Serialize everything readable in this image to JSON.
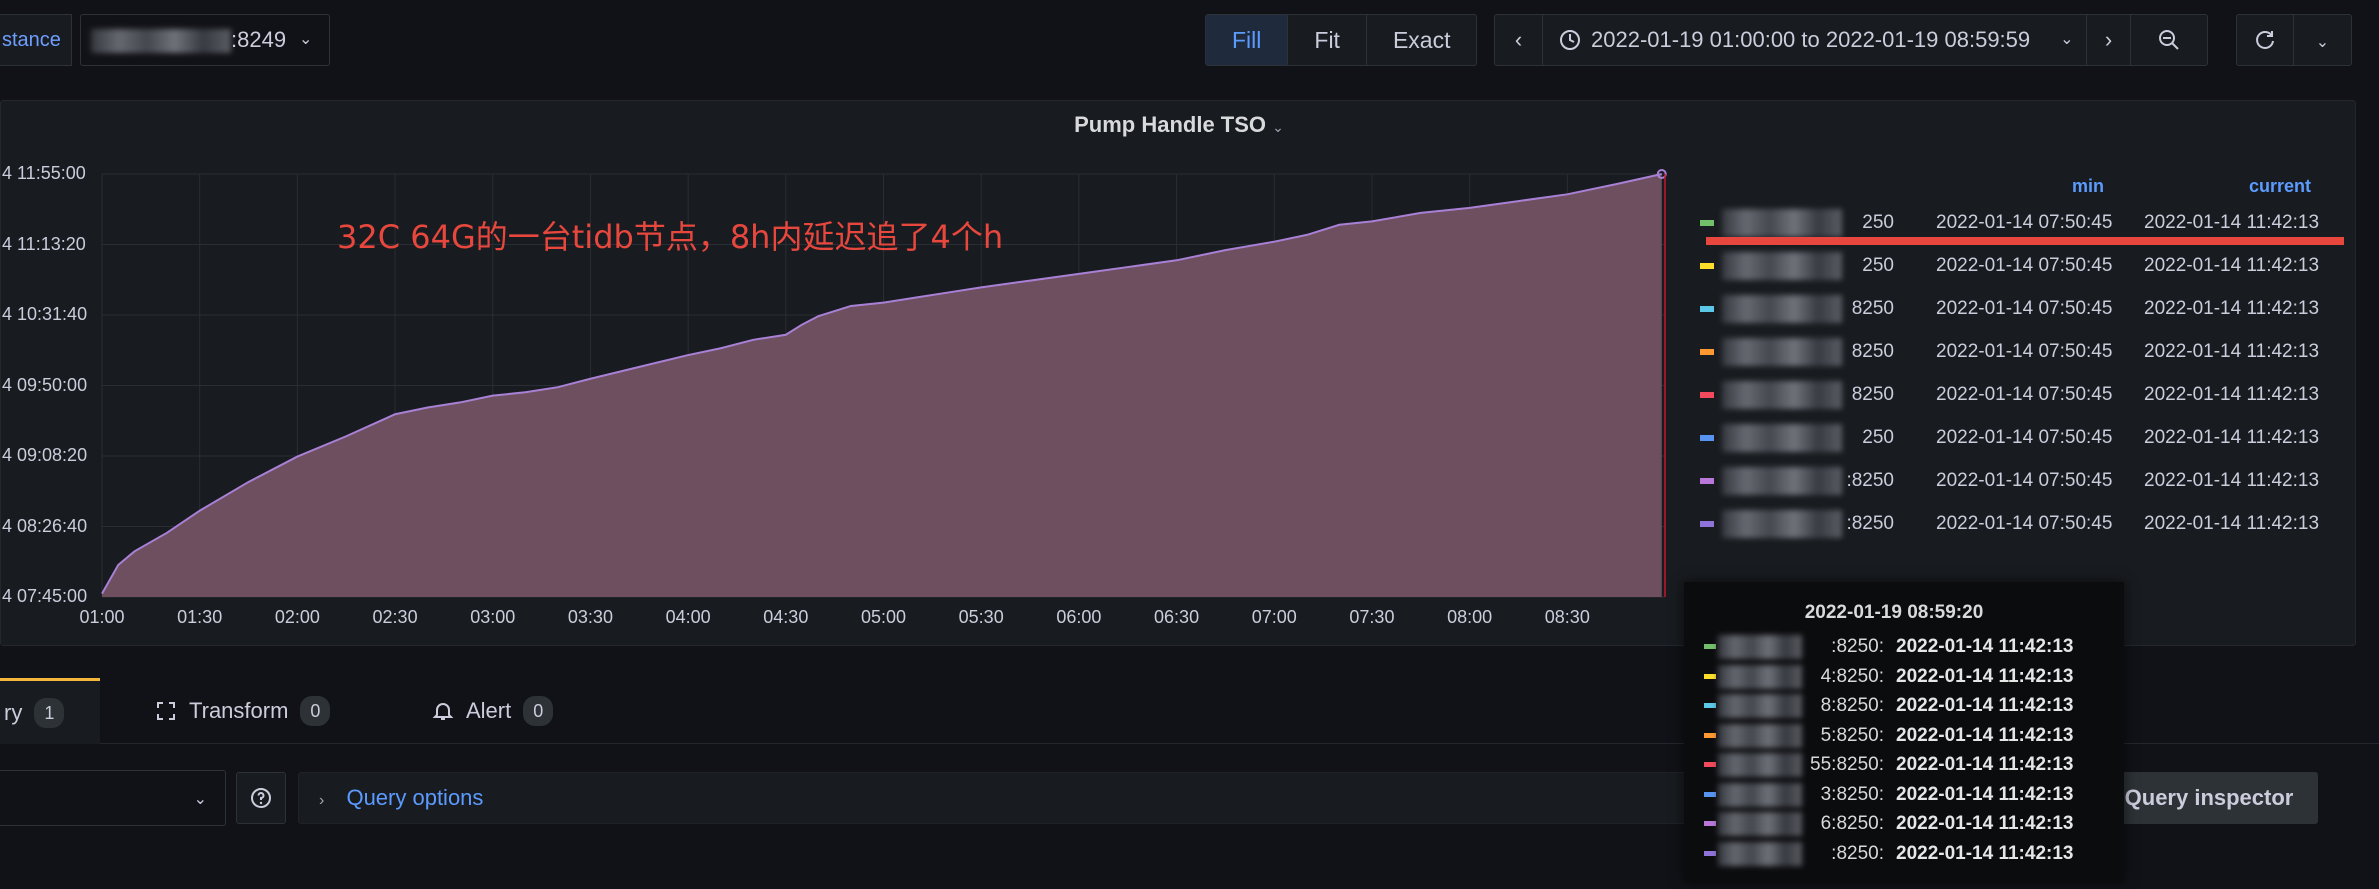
{
  "toolbar": {
    "var_label": "stance",
    "var_value": ":8249",
    "zoom_modes": [
      "Fill",
      "Fit",
      "Exact"
    ],
    "active_mode": "Fill",
    "time_range": "2022-01-19 01:00:00 to 2022-01-19 08:59:59"
  },
  "panel": {
    "title": "Pump Handle TSO",
    "annotation": "32C 64G的一台tidb节点，8h内延迟追了4个h",
    "legend_headers": {
      "min": "min",
      "current": "current"
    },
    "legend": [
      {
        "name": "250",
        "min": "2022-01-14 07:50:45",
        "current": "2022-01-14 11:42:13",
        "color": "#73bf69"
      },
      {
        "name": "250",
        "min": "2022-01-14 07:50:45",
        "current": "2022-01-14 11:42:13",
        "color": "#fade2a"
      },
      {
        "name": "8250",
        "min": "2022-01-14 07:50:45",
        "current": "2022-01-14 11:42:13",
        "color": "#5ac8e6"
      },
      {
        "name": "8250",
        "min": "2022-01-14 07:50:45",
        "current": "2022-01-14 11:42:13",
        "color": "#ff9830"
      },
      {
        "name": "8250",
        "min": "2022-01-14 07:50:45",
        "current": "2022-01-14 11:42:13",
        "color": "#f2495c"
      },
      {
        "name": "250",
        "min": "2022-01-14 07:50:45",
        "current": "2022-01-14 11:42:13",
        "color": "#5794f2"
      },
      {
        "name": ":8250",
        "min": "2022-01-14 07:50:45",
        "current": "2022-01-14 11:42:13",
        "color": "#b877d9"
      },
      {
        "name": ":8250",
        "min": "2022-01-14 07:50:45",
        "current": "2022-01-14 11:42:13",
        "color": "#8f73d9"
      }
    ]
  },
  "tooltip": {
    "time": "2022-01-19 08:59:20",
    "rows": [
      {
        "name": ":8250:",
        "value": "2022-01-14 11:42:13",
        "color": "#73bf69"
      },
      {
        "name": "4:8250:",
        "value": "2022-01-14 11:42:13",
        "color": "#fade2a"
      },
      {
        "name": "8:8250:",
        "value": "2022-01-14 11:42:13",
        "color": "#5ac8e6"
      },
      {
        "name": "5:8250:",
        "value": "2022-01-14 11:42:13",
        "color": "#ff9830"
      },
      {
        "name": "55:8250:",
        "value": "2022-01-14 11:42:13",
        "color": "#f2495c"
      },
      {
        "name": "3:8250:",
        "value": "2022-01-14 11:42:13",
        "color": "#5794f2"
      },
      {
        "name": "6:8250:",
        "value": "2022-01-14 11:42:13",
        "color": "#b877d9"
      },
      {
        "name": ":8250:",
        "value": "2022-01-14 11:42:13",
        "color": "#8f73d9"
      }
    ]
  },
  "tabs": [
    {
      "label": "ry",
      "count": "1"
    },
    {
      "label": "Transform",
      "count": "0"
    },
    {
      "label": "Alert",
      "count": "0"
    }
  ],
  "query": {
    "options_label": "Query options",
    "inspector_label": "Query inspector"
  },
  "chart_data": {
    "type": "area",
    "x_ticks": [
      "01:00",
      "01:30",
      "02:00",
      "02:30",
      "03:00",
      "03:30",
      "04:00",
      "04:30",
      "05:00",
      "05:30",
      "06:00",
      "06:30",
      "07:00",
      "07:30",
      "08:00",
      "08:30"
    ],
    "y_ticks": [
      "4 07:45:00",
      "4 08:26:40",
      "4 09:08:20",
      "4 09:50:00",
      "4 10:31:40",
      "4 11:13:20",
      "4 11:55:00"
    ],
    "series": [
      {
        "color": "#a881d6",
        "fill": "#6e4f5f",
        "x": [
          "01:00",
          "01:05",
          "01:10",
          "01:20",
          "01:30",
          "01:45",
          "02:00",
          "02:15",
          "02:30",
          "02:40",
          "02:50",
          "03:00",
          "03:10",
          "03:20",
          "03:30",
          "03:45",
          "04:00",
          "04:10",
          "04:20",
          "04:30",
          "04:35",
          "04:40",
          "04:50",
          "05:00",
          "05:10",
          "05:20",
          "05:30",
          "05:45",
          "06:00",
          "06:15",
          "06:30",
          "06:45",
          "07:00",
          "07:10",
          "07:20",
          "07:30",
          "07:45",
          "08:00",
          "08:15",
          "08:30",
          "08:45",
          "08:59"
        ],
        "y": [
          "07:47:00",
          "08:04:00",
          "08:12:00",
          "08:23:00",
          "08:36:00",
          "08:53:00",
          "09:08:00",
          "09:20:00",
          "09:33:00",
          "09:37:00",
          "09:40:00",
          "09:44:00",
          "09:46:00",
          "09:49:00",
          "09:54:00",
          "10:01:00",
          "10:08:00",
          "10:12:00",
          "10:17:00",
          "10:20:00",
          "10:26:00",
          "10:31:00",
          "10:37:00",
          "10:39:00",
          "10:42:00",
          "10:45:00",
          "10:48:00",
          "10:52:00",
          "10:56:00",
          "11:00:00",
          "11:04:00",
          "11:10:00",
          "11:15:00",
          "11:19:00",
          "11:25:00",
          "11:27:00",
          "11:32:00",
          "11:35:00",
          "11:39:00",
          "11:43:00",
          "11:49:00",
          "11:55:00"
        ]
      }
    ]
  }
}
